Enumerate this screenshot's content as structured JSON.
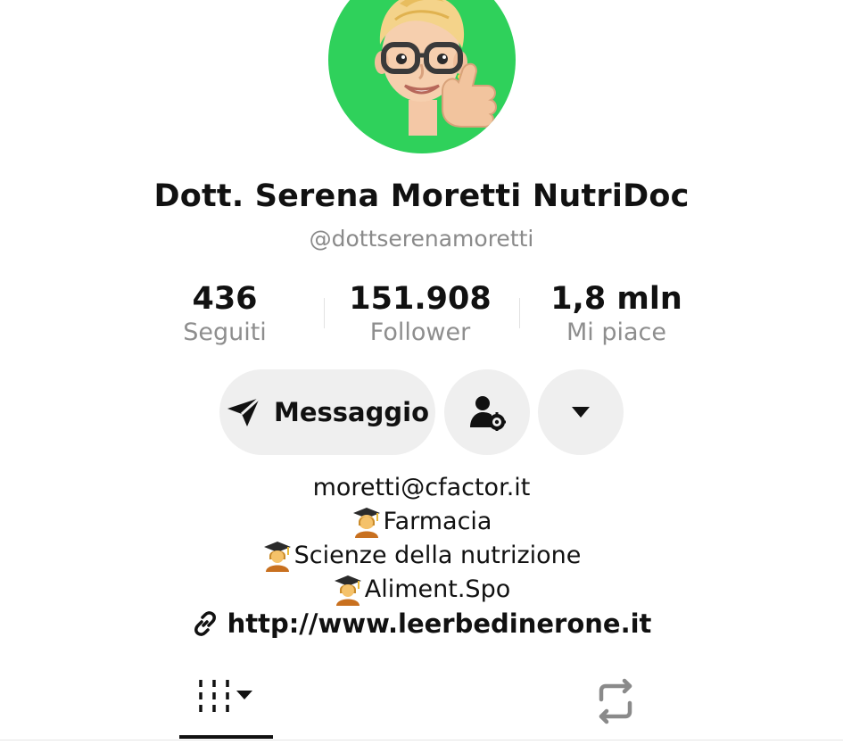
{
  "profile": {
    "display_name": "Dott. Serena Moretti NutriDoc",
    "handle": "@dottserenamoretti",
    "avatar_bg": "#2fd15b"
  },
  "stats": [
    {
      "value": "436",
      "label": "Seguiti"
    },
    {
      "value": "151.908",
      "label": "Follower"
    },
    {
      "value": "1,8 mln",
      "label": "Mi piace"
    }
  ],
  "actions": {
    "message_label": "Messaggio",
    "message_icon": "send-icon",
    "user_icon": "user-settings-icon",
    "more_icon": "caret-down-icon"
  },
  "bio": {
    "email": "moretti@cfactor.it",
    "lines": [
      "Farmacia",
      "Scienze della nutrizione",
      "Aliment.Spo"
    ],
    "line_icon": "graduate-emoji",
    "link": "http://www.leerbedinerone.it",
    "link_icon": "link-icon"
  },
  "tabs": {
    "videos_icon": "grid-icon",
    "reposts_icon": "repost-icon",
    "active": "videos"
  }
}
